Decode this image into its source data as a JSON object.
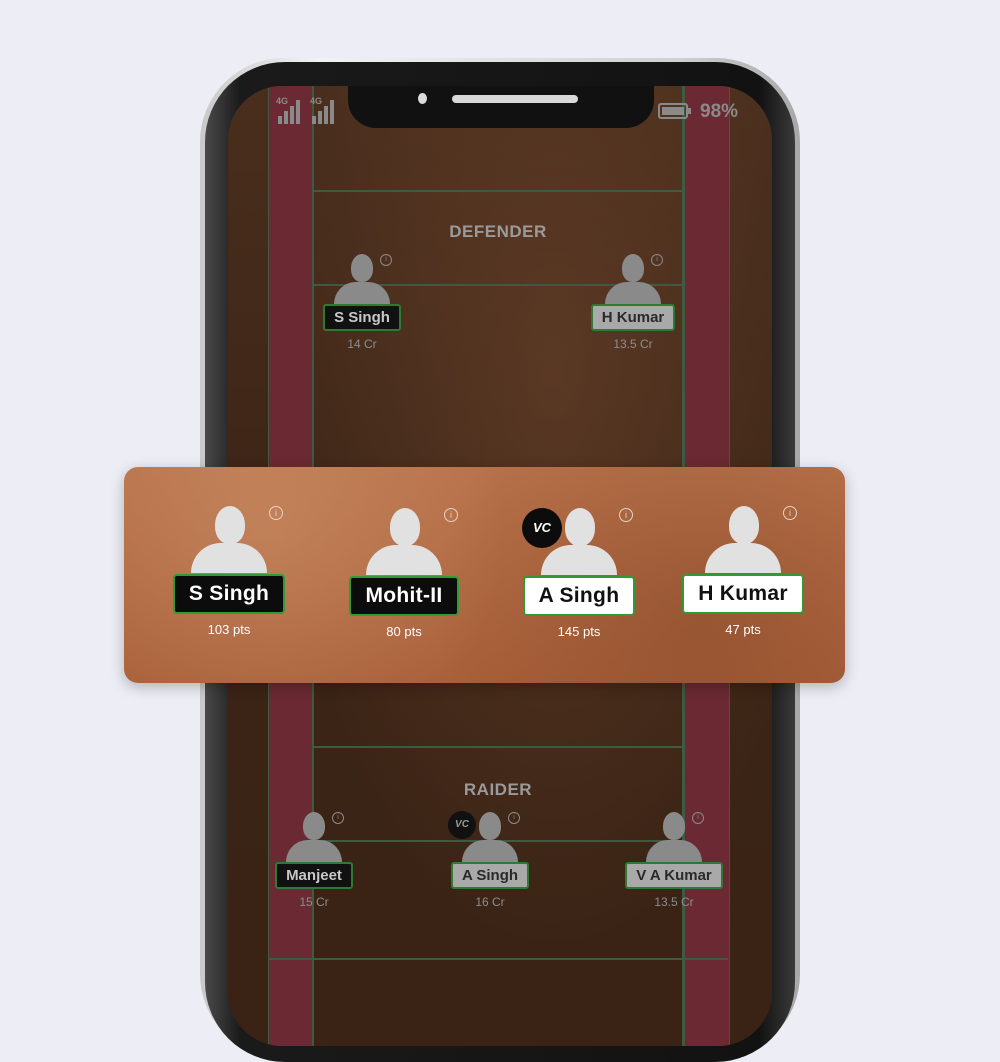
{
  "status_bar": {
    "signal_labels": [
      "4G",
      "4G"
    ],
    "battery_percent": "98%",
    "battery_level": 0.98
  },
  "sections": {
    "defender": "DEFENDER",
    "raider": "RAIDER"
  },
  "defenders": [
    {
      "name": "S Singh",
      "credits": "14 Cr",
      "style": "dark"
    },
    {
      "name": "H Kumar",
      "credits": "13.5 Cr",
      "style": "light"
    }
  ],
  "raiders": [
    {
      "name": "Manjeet",
      "credits": "15 Cr",
      "style": "dark"
    },
    {
      "name": "A Singh",
      "credits": "16 Cr",
      "style": "light",
      "badge": "VC"
    },
    {
      "name": "V A Kumar",
      "credits": "13.5 Cr",
      "style": "light"
    }
  ],
  "highlight": {
    "players": [
      {
        "name": "S Singh",
        "points": "103 pts",
        "style": "dark"
      },
      {
        "name": "Mohit-II",
        "points": "80 pts",
        "style": "dark"
      },
      {
        "name": "A Singh",
        "points": "145 pts",
        "style": "light",
        "badge": "VC"
      },
      {
        "name": "H Kumar",
        "points": "47 pts",
        "style": "light"
      }
    ]
  },
  "colors": {
    "background": "#ecedf5",
    "court": "#3d2618",
    "lane": "#6b2a33",
    "panel": "#b06a42",
    "tag_border": "#2f9a36"
  }
}
